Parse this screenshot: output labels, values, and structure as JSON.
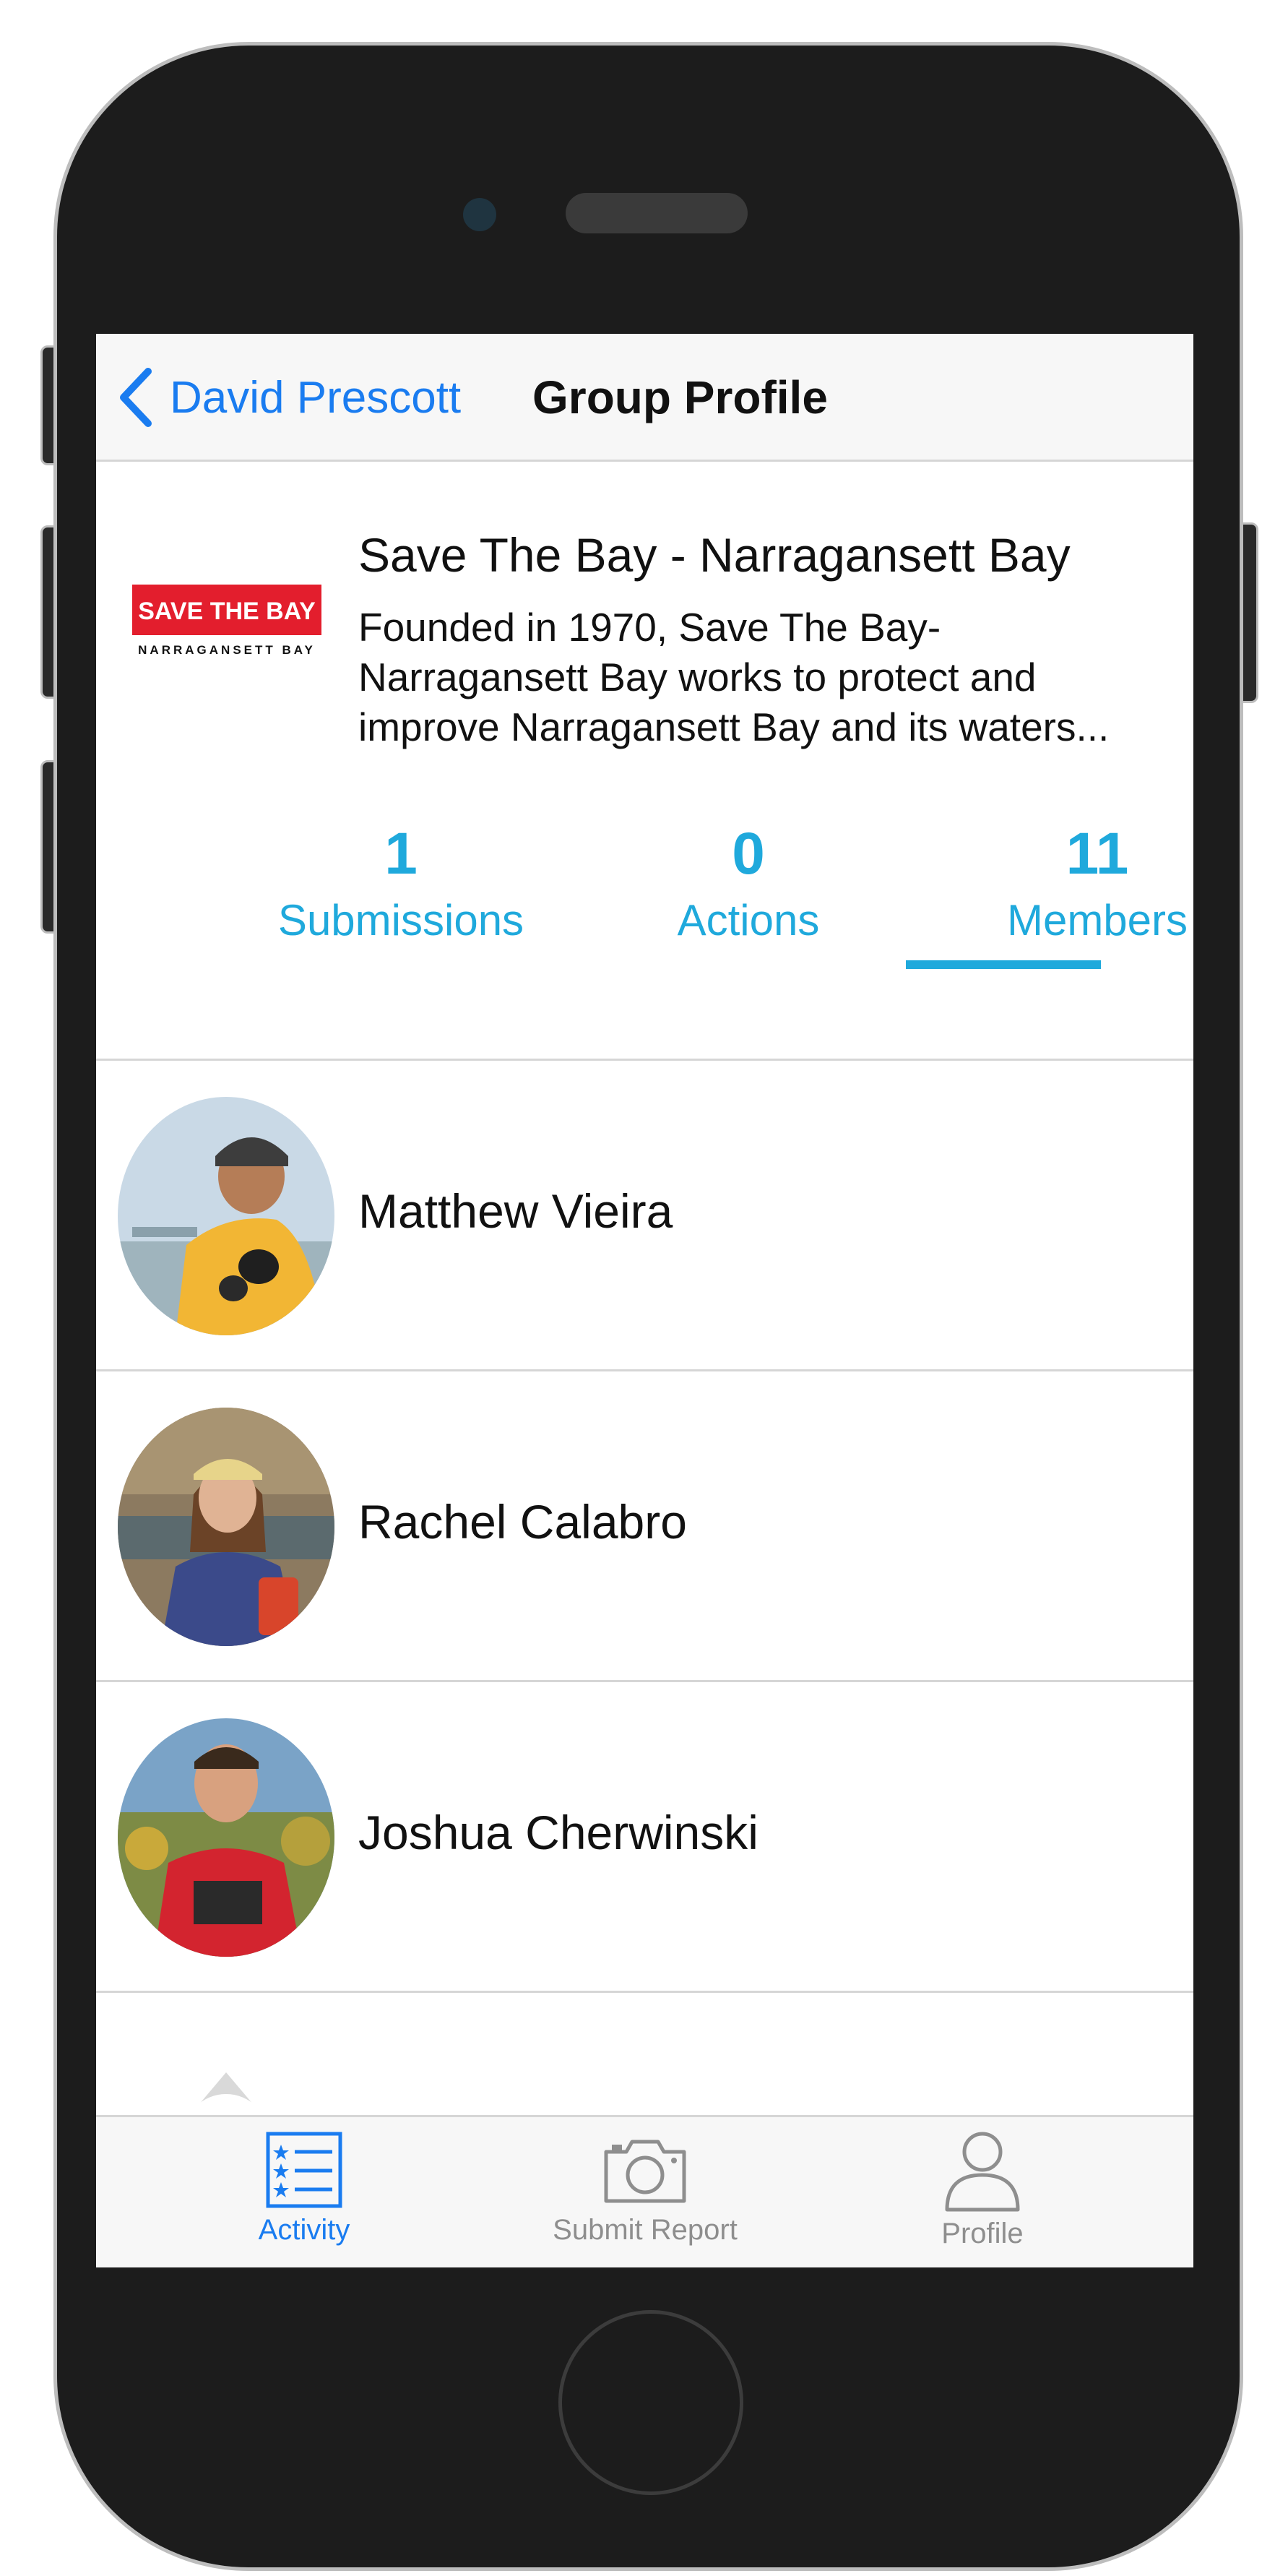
{
  "nav": {
    "back_label": "David Prescott",
    "title": "Group Profile"
  },
  "group": {
    "logo_text": "SAVE THE BAY",
    "logo_subtext": "NARRAGANSETT BAY",
    "name": "Save The Bay - Narragansett Bay",
    "description_lines": [
      "Founded in 1970, Save The Bay-",
      "Narragansett Bay works to protect and",
      "improve Narragansett Bay and its waters..."
    ]
  },
  "stats": [
    {
      "count": "1",
      "label": "Submissions"
    },
    {
      "count": "0",
      "label": "Actions"
    },
    {
      "count": "11",
      "label": "Members",
      "active": true
    }
  ],
  "members": [
    {
      "name": "Matthew Vieira"
    },
    {
      "name": "Rachel Calabro"
    },
    {
      "name": "Joshua Cherwinski"
    }
  ],
  "tabs": [
    {
      "label": "Activity",
      "icon": "list-icon",
      "active": true
    },
    {
      "label": "Submit Report",
      "icon": "camera-icon"
    },
    {
      "label": "Profile",
      "icon": "person-icon"
    }
  ],
  "colors": {
    "ios_blue": "#1a7cf0",
    "accent_cyan": "#1fa9dc",
    "logo_red": "#e31e2d",
    "tab_inactive": "#8e8e8e"
  }
}
